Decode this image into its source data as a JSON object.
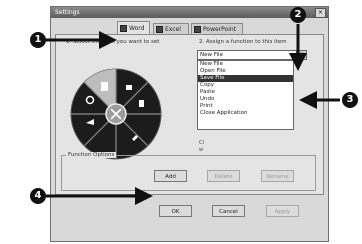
{
  "window": {
    "title": "Settings",
    "close_glyph": "×"
  },
  "tabs": [
    {
      "label": "Word",
      "icon": "word-icon",
      "active": true
    },
    {
      "label": "Excel",
      "icon": "excel-icon",
      "active": false
    },
    {
      "label": "PowerPoint",
      "icon": "powerpoint-icon",
      "active": false
    }
  ],
  "steps": {
    "step1": "1. Select the item you want to set",
    "step2": "2. Assign a function to this item"
  },
  "dropdown": {
    "value": "New File",
    "arrow": "▼",
    "options": [
      "New File",
      "Open File",
      "Save File",
      "Copy",
      "Paste",
      "Undo",
      "Print",
      "Close Application"
    ],
    "selected_index": 2
  },
  "obscured_fragments": [
    "In",
    "Se",
    "of",
    "Cl",
    "w"
  ],
  "function_options": {
    "title": "Function Options",
    "add_label": "Add",
    "delete_label": "Delete",
    "rename_label": "Rename"
  },
  "footer": {
    "ok_label": "OK",
    "cancel_label": "Cancel",
    "apply_label": "Apply"
  },
  "callouts": [
    "1",
    "2",
    "3",
    "4"
  ]
}
